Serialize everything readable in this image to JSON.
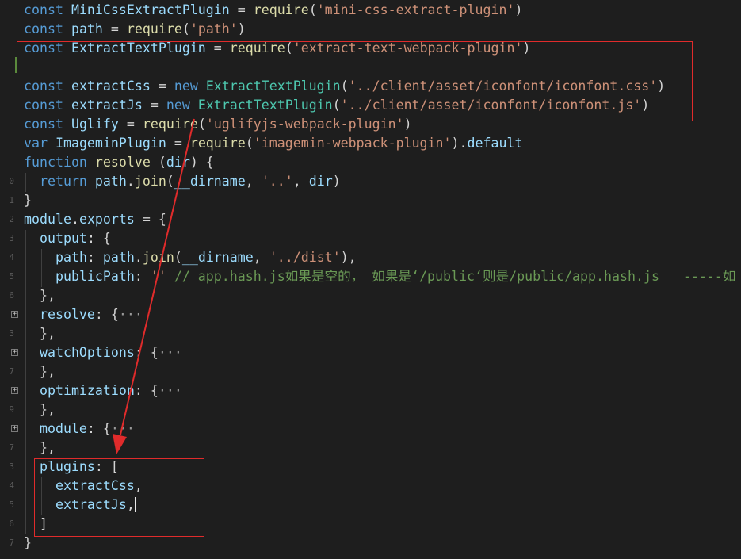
{
  "editor": {
    "lines": [
      {
        "n": "",
        "tokens": [
          [
            "kw",
            "const "
          ],
          [
            "var",
            "MiniCssExtractPlugin"
          ],
          [
            "plain",
            " = "
          ],
          [
            "fn",
            "require"
          ],
          [
            "plain",
            "("
          ],
          [
            "str",
            "'mini-css-extract-plugin'"
          ],
          [
            "plain",
            ")"
          ]
        ]
      },
      {
        "n": "",
        "tokens": [
          [
            "kw",
            "const "
          ],
          [
            "var",
            "path"
          ],
          [
            "plain",
            " = "
          ],
          [
            "fn",
            "require"
          ],
          [
            "plain",
            "("
          ],
          [
            "str",
            "'path'"
          ],
          [
            "plain",
            ")"
          ]
        ]
      },
      {
        "n": "",
        "tokens": [
          [
            "kw",
            "const "
          ],
          [
            "var",
            "ExtractTextPlugin"
          ],
          [
            "plain",
            " = "
          ],
          [
            "fn",
            "require"
          ],
          [
            "plain",
            "("
          ],
          [
            "str",
            "'extract-text-webpack-plugin'"
          ],
          [
            "plain",
            ")"
          ]
        ]
      },
      {
        "n": "",
        "tokens": []
      },
      {
        "n": "",
        "tokens": [
          [
            "kw",
            "const "
          ],
          [
            "var",
            "extractCss"
          ],
          [
            "plain",
            " = "
          ],
          [
            "kw",
            "new "
          ],
          [
            "cls",
            "ExtractTextPlugin"
          ],
          [
            "plain",
            "("
          ],
          [
            "str",
            "'../client/asset/iconfont/iconfont.css'"
          ],
          [
            "plain",
            ")"
          ]
        ]
      },
      {
        "n": "",
        "tokens": [
          [
            "kw",
            "const "
          ],
          [
            "var",
            "extractJs"
          ],
          [
            "plain",
            " = "
          ],
          [
            "kw",
            "new "
          ],
          [
            "cls",
            "ExtractTextPlugin"
          ],
          [
            "plain",
            "("
          ],
          [
            "str",
            "'../client/asset/iconfont/iconfont.js'"
          ],
          [
            "plain",
            ")"
          ]
        ]
      },
      {
        "n": "",
        "tokens": [
          [
            "kw",
            "const "
          ],
          [
            "var",
            "Uglify"
          ],
          [
            "plain",
            " = "
          ],
          [
            "fn",
            "require"
          ],
          [
            "plain",
            "("
          ],
          [
            "str",
            "'uglifyjs-webpack-plugin'"
          ],
          [
            "plain",
            ")"
          ]
        ]
      },
      {
        "n": "",
        "tokens": [
          [
            "kw",
            "var "
          ],
          [
            "var",
            "ImageminPlugin"
          ],
          [
            "plain",
            " = "
          ],
          [
            "fn",
            "require"
          ],
          [
            "plain",
            "("
          ],
          [
            "str",
            "'imagemin-webpack-plugin'"
          ],
          [
            "plain",
            ")."
          ],
          [
            "var",
            "default"
          ]
        ]
      },
      {
        "n": "",
        "tokens": [
          [
            "kw",
            "function "
          ],
          [
            "fn",
            "resolve"
          ],
          [
            "plain",
            " ("
          ],
          [
            "var",
            "dir"
          ],
          [
            "plain",
            ") {"
          ]
        ]
      },
      {
        "n": "0",
        "tokens": [
          [
            "plain",
            "  "
          ],
          [
            "kw",
            "return "
          ],
          [
            "var",
            "path"
          ],
          [
            "plain",
            "."
          ],
          [
            "fn",
            "join"
          ],
          [
            "plain",
            "("
          ],
          [
            "var",
            "__dirname"
          ],
          [
            "plain",
            ", "
          ],
          [
            "str",
            "'..'"
          ],
          [
            "plain",
            ", "
          ],
          [
            "var",
            "dir"
          ],
          [
            "plain",
            ")"
          ]
        ]
      },
      {
        "n": "1",
        "tokens": [
          [
            "plain",
            "}"
          ]
        ]
      },
      {
        "n": "2",
        "tokens": [
          [
            "var",
            "module"
          ],
          [
            "plain",
            "."
          ],
          [
            "var",
            "exports"
          ],
          [
            "plain",
            " = {"
          ]
        ]
      },
      {
        "n": "3",
        "tokens": [
          [
            "plain",
            "  "
          ],
          [
            "var",
            "output"
          ],
          [
            "plain",
            ": {"
          ]
        ]
      },
      {
        "n": "4",
        "tokens": [
          [
            "plain",
            "    "
          ],
          [
            "var",
            "path"
          ],
          [
            "plain",
            ": "
          ],
          [
            "var",
            "path"
          ],
          [
            "plain",
            "."
          ],
          [
            "fn",
            "join"
          ],
          [
            "plain",
            "("
          ],
          [
            "var",
            "__dirname"
          ],
          [
            "plain",
            ", "
          ],
          [
            "str",
            "'../dist'"
          ],
          [
            "plain",
            "),"
          ]
        ]
      },
      {
        "n": "5",
        "tokens": [
          [
            "plain",
            "    "
          ],
          [
            "var",
            "publicPath"
          ],
          [
            "plain",
            ": "
          ],
          [
            "str",
            "''"
          ],
          [
            "cm",
            " // app.hash.js如果是空的， 如果是‘/public‘则是/public/app.hash.js   -----如"
          ]
        ]
      },
      {
        "n": "6",
        "tokens": [
          [
            "plain",
            "  },"
          ]
        ]
      },
      {
        "n": "",
        "fold": "+",
        "tokens": [
          [
            "plain",
            "  "
          ],
          [
            "var",
            "resolve"
          ],
          [
            "plain",
            ": {"
          ],
          [
            "ellipsis",
            "···"
          ]
        ]
      },
      {
        "n": "3",
        "tokens": [
          [
            "plain",
            "  },"
          ]
        ]
      },
      {
        "n": "",
        "fold": "+",
        "tokens": [
          [
            "plain",
            "  "
          ],
          [
            "var",
            "watchOptions"
          ],
          [
            "plain",
            ": {"
          ],
          [
            "ellipsis",
            "···"
          ]
        ]
      },
      {
        "n": "7",
        "tokens": [
          [
            "plain",
            "  },"
          ]
        ]
      },
      {
        "n": "",
        "fold": "+",
        "tokens": [
          [
            "plain",
            "  "
          ],
          [
            "var",
            "optimization"
          ],
          [
            "plain",
            ": {"
          ],
          [
            "ellipsis",
            "···"
          ]
        ]
      },
      {
        "n": "9",
        "tokens": [
          [
            "plain",
            "  },"
          ]
        ]
      },
      {
        "n": "",
        "fold": "+",
        "tokens": [
          [
            "plain",
            "  "
          ],
          [
            "var",
            "module"
          ],
          [
            "plain",
            ": {"
          ],
          [
            "ellipsis",
            "···"
          ]
        ]
      },
      {
        "n": "7",
        "tokens": [
          [
            "plain",
            "  },"
          ]
        ]
      },
      {
        "n": "3",
        "tokens": [
          [
            "plain",
            "  "
          ],
          [
            "var",
            "plugins"
          ],
          [
            "plain",
            ": ["
          ]
        ]
      },
      {
        "n": "4",
        "tokens": [
          [
            "plain",
            "    "
          ],
          [
            "var",
            "extractCss"
          ],
          [
            "plain",
            ","
          ]
        ]
      },
      {
        "n": "5",
        "tokens": [
          [
            "plain",
            "    "
          ],
          [
            "var",
            "extractJs"
          ],
          [
            "plain",
            ","
          ]
        ]
      },
      {
        "n": "6",
        "tokens": [
          [
            "plain",
            "  ]"
          ]
        ]
      },
      {
        "n": "7",
        "tokens": [
          [
            "plain",
            "}"
          ]
        ]
      }
    ]
  },
  "colors": {
    "background": "#1e1e1e",
    "annotation_red": "#e02b2b"
  }
}
